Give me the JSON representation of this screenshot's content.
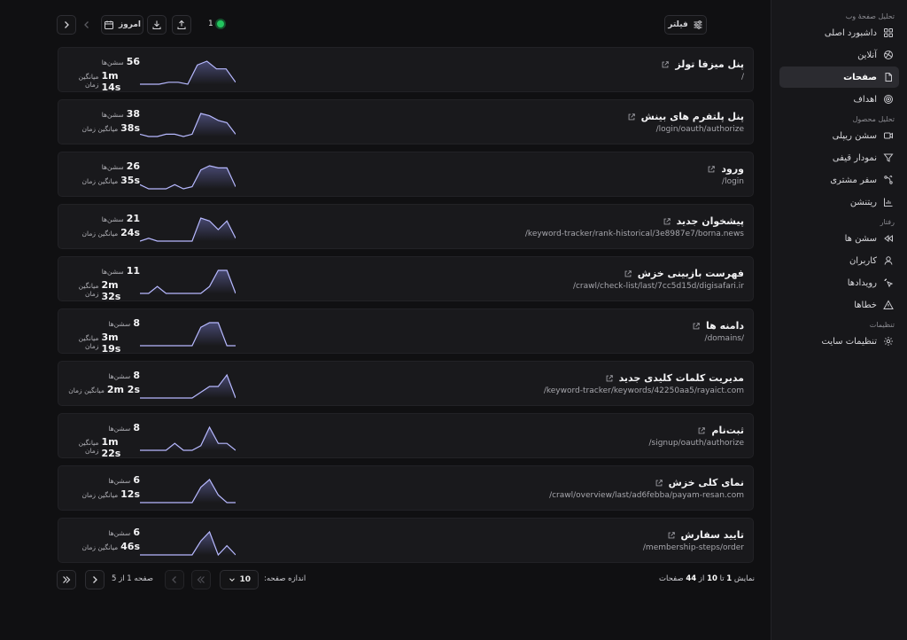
{
  "sidebar": {
    "groups": [
      {
        "label": "تحلیل صفحهٔ وب",
        "items": [
          {
            "label": "داشبورد اصلی",
            "icon": "dashboard-icon",
            "active": false
          },
          {
            "label": "آنلاین",
            "icon": "online-icon",
            "active": false
          },
          {
            "label": "صفحات",
            "icon": "file-icon",
            "active": true
          },
          {
            "label": "اهداف",
            "icon": "target-icon",
            "active": false
          }
        ]
      },
      {
        "label": "تحلیل محصول",
        "items": [
          {
            "label": "سشن ریپلی",
            "icon": "video-icon",
            "active": false
          },
          {
            "label": "نمودار قیفی",
            "icon": "funnel-icon",
            "active": false
          },
          {
            "label": "سفر مشتری",
            "icon": "journey-icon",
            "active": false
          },
          {
            "label": "ریتنشن",
            "icon": "chart-icon",
            "active": false
          }
        ]
      },
      {
        "label": "رفتار",
        "items": [
          {
            "label": "سشن ها",
            "icon": "rewind-icon",
            "active": false
          },
          {
            "label": "کاربران",
            "icon": "user-icon",
            "active": false
          },
          {
            "label": "رویدادها",
            "icon": "click-icon",
            "active": false
          },
          {
            "label": "خطاها",
            "icon": "warning-icon",
            "active": false
          }
        ]
      },
      {
        "label": "تنظیمات",
        "items": [
          {
            "label": "تنظیمات سایت",
            "icon": "gear-icon",
            "active": false
          }
        ]
      }
    ]
  },
  "toolbar": {
    "today_label": "امروز",
    "online_count": "1",
    "filter_label": "فیلتر"
  },
  "labels": {
    "sessions": "سشن‌ها",
    "avg_time": "میانگین زمان"
  },
  "pages": [
    {
      "title": "پنل میزفا تولز",
      "path": "/",
      "sessions": "56",
      "avg": "1m 14s",
      "trend": [
        0,
        0,
        0,
        1,
        1,
        0,
        10,
        12,
        8,
        8,
        1
      ]
    },
    {
      "title": "پنل پلتفرم های بینش",
      "path": "/login/oauth/authorize",
      "sessions": "38",
      "avg": "38s",
      "trend": [
        1,
        0,
        0,
        1,
        1,
        0,
        1,
        10,
        9,
        7,
        6,
        1
      ]
    },
    {
      "title": "ورود",
      "path": "/login",
      "sessions": "26",
      "avg": "35s",
      "trend": [
        2,
        0,
        0,
        0,
        2,
        0,
        1,
        9,
        11,
        10,
        10,
        1
      ]
    },
    {
      "title": "پیشخوان جدید",
      "path": "/keyword-tracker/rank-historical/3e8987e7/borna.news",
      "sessions": "21",
      "avg": "24s",
      "trend": [
        0,
        1,
        0,
        0,
        0,
        0,
        0,
        8,
        7,
        4,
        7,
        1
      ]
    },
    {
      "title": "فهرست بازبینی خزش",
      "path": "/crawl/check-list/last/7cc5d15d/digisafari.ir",
      "sessions": "11",
      "avg": "2m 32s",
      "trend": [
        0,
        0,
        3,
        0,
        0,
        0,
        0,
        0,
        3,
        10,
        10,
        0
      ]
    },
    {
      "title": "دامنه ها",
      "path": "/domains/",
      "sessions": "8",
      "avg": "3m 19s",
      "trend": [
        0,
        0,
        0,
        0,
        0,
        0,
        0,
        8,
        10,
        10,
        0,
        0
      ]
    },
    {
      "title": "مدیریت کلمات کلیدی جدید",
      "path": "/keyword-tracker/keywords/42250aa5/rayaict.com",
      "sessions": "8",
      "avg": "2m 2s",
      "trend": [
        0,
        0,
        0,
        0,
        0,
        0,
        0,
        2,
        4,
        4,
        8,
        0
      ]
    },
    {
      "title": "ثبت‌نام",
      "path": "/signup/oauth/authorize",
      "sessions": "8",
      "avg": "1m 22s",
      "trend": [
        0,
        0,
        0,
        0,
        3,
        0,
        0,
        2,
        10,
        3,
        3,
        0
      ]
    },
    {
      "title": "نمای کلی خزش",
      "path": "/crawl/overview/last/ad6febba/payam-resan.com",
      "sessions": "6",
      "avg": "12s",
      "trend": [
        0,
        0,
        0,
        0,
        0,
        0,
        0,
        8,
        12,
        4,
        0,
        0
      ]
    },
    {
      "title": "تایید سفارش",
      "path": "/membership-steps/order",
      "sessions": "6",
      "avg": "46s",
      "trend": [
        0,
        0,
        0,
        0,
        0,
        0,
        0,
        6,
        10,
        0,
        4,
        0
      ]
    }
  ],
  "pagination": {
    "page_size_label": "اندازه صفحه:",
    "page_size": "10",
    "page_text": "صفحه 1 از 5",
    "showing_prefix": "نمایش",
    "showing_from": "1",
    "showing_to_word": "تا",
    "showing_to": "10",
    "showing_of_word": "از",
    "showing_total": "44",
    "showing_suffix": "صفحات"
  },
  "colors": {
    "accent_line": "#b7b9ff",
    "online_dot": "#22c55e",
    "active_bg": "#2b2b30"
  }
}
